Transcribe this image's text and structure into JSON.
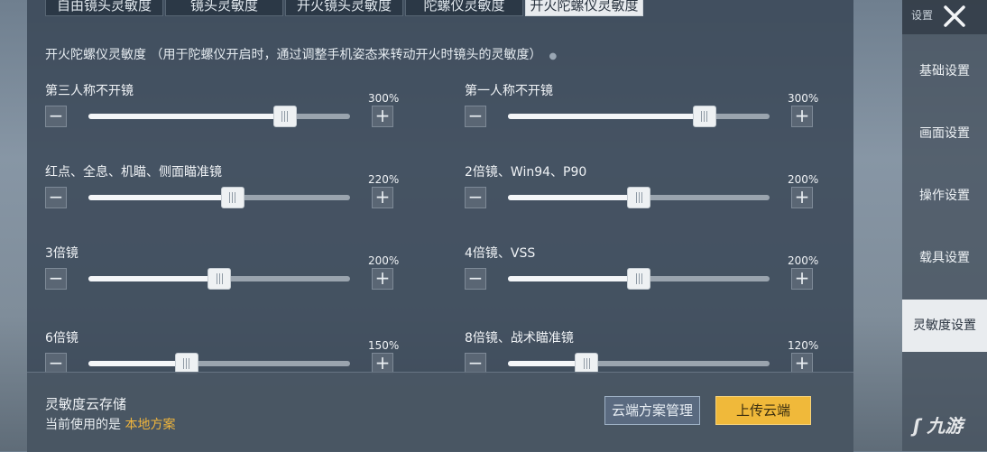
{
  "tabs": [
    {
      "label": "自由镜头灵敏度",
      "active": false
    },
    {
      "label": "镜头灵敏度",
      "active": false
    },
    {
      "label": "开火镜头灵敏度",
      "active": false
    },
    {
      "label": "陀螺仪灵敏度",
      "active": false
    },
    {
      "label": "开火陀螺仪灵敏度",
      "active": true
    }
  ],
  "description": "开火陀螺仪灵敏度 （用于陀螺仪开启时，通过调整手机姿态来转动开火时镜头的灵敏度）",
  "sliders": [
    {
      "label": "第三人称不开镜",
      "value": "300%",
      "fraction": 0.75
    },
    {
      "label": "第一人称不开镜",
      "value": "300%",
      "fraction": 0.75
    },
    {
      "label": "红点、全息、机瞄、侧面瞄准镜",
      "value": "220%",
      "fraction": 0.55
    },
    {
      "label": "2倍镜、Win94、P90",
      "value": "200%",
      "fraction": 0.5
    },
    {
      "label": "3倍镜",
      "value": "200%",
      "fraction": 0.5
    },
    {
      "label": "4倍镜、VSS",
      "value": "200%",
      "fraction": 0.5
    },
    {
      "label": "6倍镜",
      "value": "150%",
      "fraction": 0.375
    },
    {
      "label": "8倍镜、战术瞄准镜",
      "value": "120%",
      "fraction": 0.3
    }
  ],
  "buttons": {
    "minus": "−",
    "plus": "+"
  },
  "cloud": {
    "title": "灵敏度云存储",
    "status_prefix": "当前使用的是",
    "status_value": "本地方案",
    "manage_label": "云端方案管理",
    "upload_label": "上传云端"
  },
  "sidebar": {
    "title": "设置",
    "items": [
      {
        "label": "基础设置",
        "active": false
      },
      {
        "label": "画面设置",
        "active": false
      },
      {
        "label": "操作设置",
        "active": false
      },
      {
        "label": "载具设置",
        "active": false
      },
      {
        "label": "灵敏度设置",
        "active": true
      }
    ]
  },
  "watermark": "九游",
  "colors": {
    "accent": "#f0b93a",
    "highlight": "#f0b53c",
    "active_tab": "#e8ebee"
  }
}
